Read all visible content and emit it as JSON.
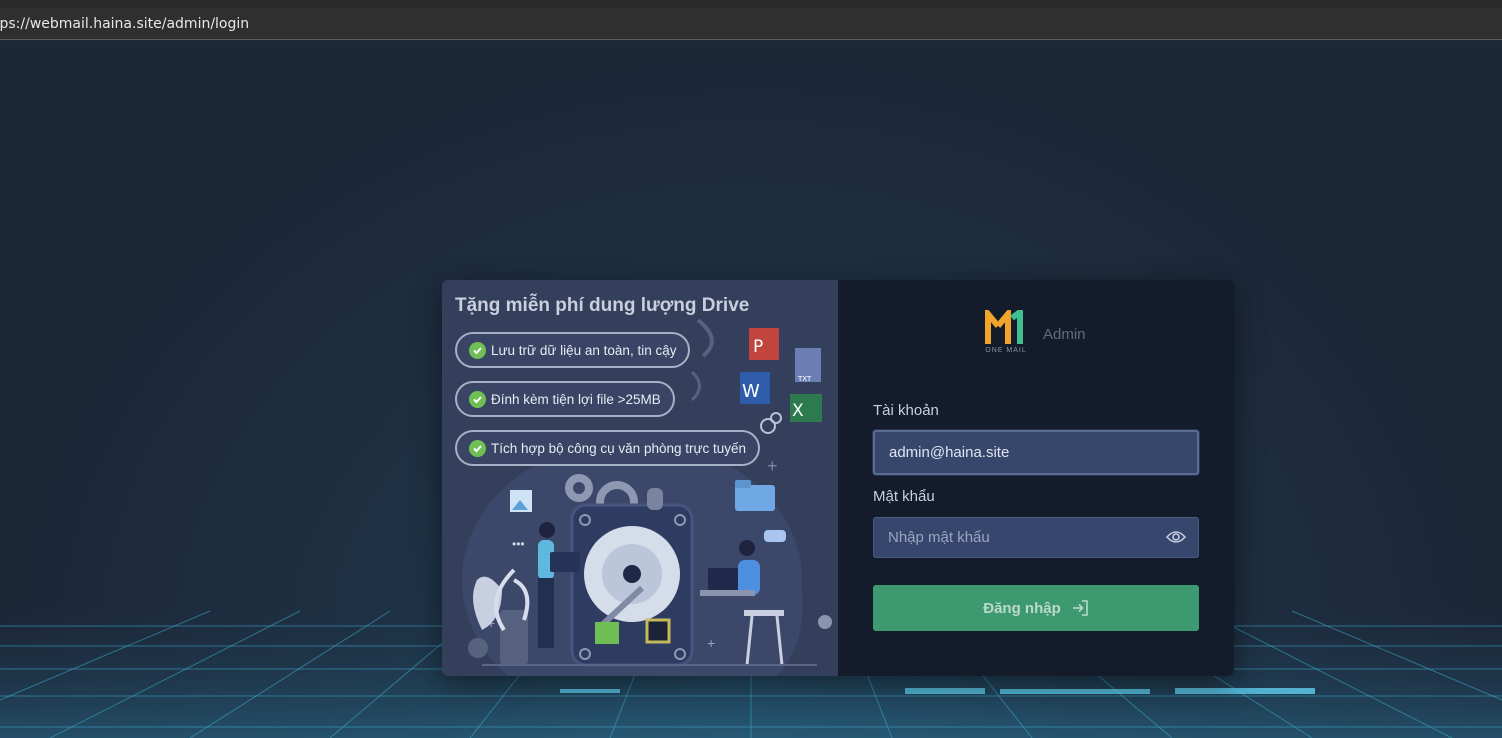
{
  "browser": {
    "url": "tps://webmail.haina.site/admin/login"
  },
  "promo": {
    "title": "Tặng miễn phí dung lượng Drive",
    "features": [
      "Lưu trữ dữ liệu an toàn, tin cậy",
      "Đính kèm tiện lợi file >25MB",
      "Tích hợp bộ công cụ văn phòng trực tuyến"
    ]
  },
  "login": {
    "logo_subtext": "ONE MAIL",
    "admin_label": "Admin",
    "account_label": "Tài khoản",
    "account_value": "admin@haina.site",
    "password_label": "Mật khẩu",
    "password_placeholder": "Nhập mật khẩu",
    "submit_label": "Đăng nhập"
  },
  "colors": {
    "background": "#1f2a3b",
    "promo_panel": "#343f5c",
    "login_panel": "#141c2c",
    "button": "#3d9a70",
    "input": "#36466c",
    "check": "#6fbf54"
  },
  "icons": [
    "check-circle-icon",
    "eye-icon",
    "login-arrow-icon",
    "onemail-logo"
  ]
}
